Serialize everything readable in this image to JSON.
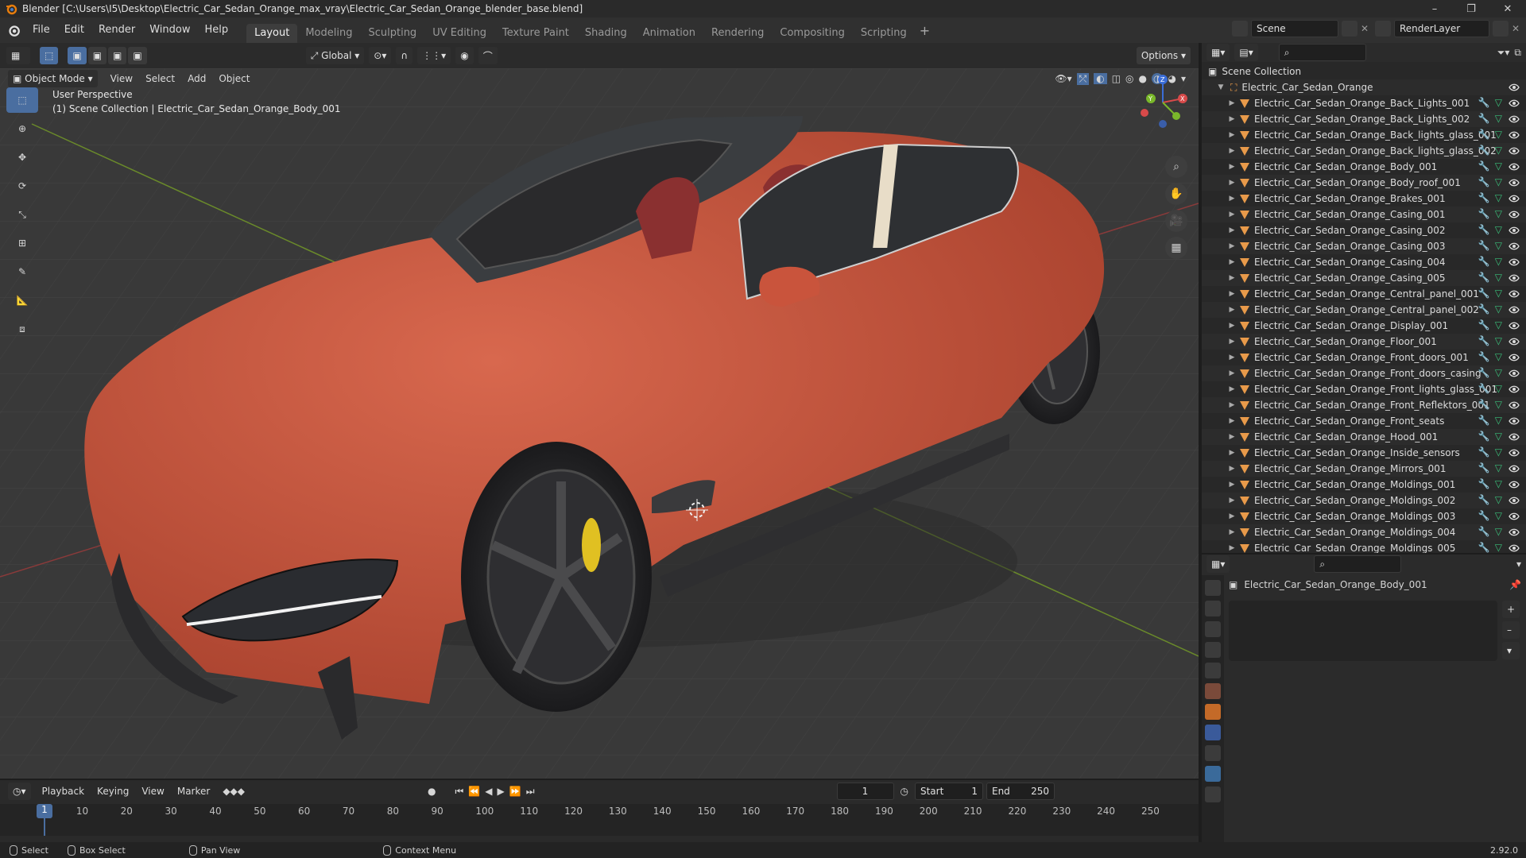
{
  "window": {
    "title": "Blender [C:\\Users\\I5\\Desktop\\Electric_Car_Sedan_Orange_max_vray\\Electric_Car_Sedan_Orange_blender_base.blend]"
  },
  "menu": [
    "File",
    "Edit",
    "Render",
    "Window",
    "Help"
  ],
  "workspaces": [
    {
      "label": "Layout",
      "active": true
    },
    {
      "label": "Modeling"
    },
    {
      "label": "Sculpting"
    },
    {
      "label": "UV Editing"
    },
    {
      "label": "Texture Paint"
    },
    {
      "label": "Shading"
    },
    {
      "label": "Animation"
    },
    {
      "label": "Rendering"
    },
    {
      "label": "Compositing"
    },
    {
      "label": "Scripting"
    }
  ],
  "scene": {
    "label": "Scene",
    "render_layer": "RenderLayer"
  },
  "toolheader": {
    "orientation": "Global",
    "options": "Options"
  },
  "viewport_header": {
    "mode": "Object Mode",
    "menus": [
      "View",
      "Select",
      "Add",
      "Object"
    ]
  },
  "viewport_info": {
    "perspective": "User Perspective",
    "collection": "(1) Scene Collection | Electric_Car_Sedan_Orange_Body_001"
  },
  "outliner": {
    "root": "Scene Collection",
    "collection": "Electric_Car_Sedan_Orange",
    "items": [
      "Electric_Car_Sedan_Orange_Back_Lights_001",
      "Electric_Car_Sedan_Orange_Back_Lights_002",
      "Electric_Car_Sedan_Orange_Back_lights_glass_001",
      "Electric_Car_Sedan_Orange_Back_lights_glass_002",
      "Electric_Car_Sedan_Orange_Body_001",
      "Electric_Car_Sedan_Orange_Body_roof_001",
      "Electric_Car_Sedan_Orange_Brakes_001",
      "Electric_Car_Sedan_Orange_Casing_001",
      "Electric_Car_Sedan_Orange_Casing_002",
      "Electric_Car_Sedan_Orange_Casing_003",
      "Electric_Car_Sedan_Orange_Casing_004",
      "Electric_Car_Sedan_Orange_Casing_005",
      "Electric_Car_Sedan_Orange_Central_panel_001",
      "Electric_Car_Sedan_Orange_Central_panel_002",
      "Electric_Car_Sedan_Orange_Display_001",
      "Electric_Car_Sedan_Orange_Floor_001",
      "Electric_Car_Sedan_Orange_Front_doors_001",
      "Electric_Car_Sedan_Orange_Front_doors_casing",
      "Electric_Car_Sedan_Orange_Front_lights_glass_001",
      "Electric_Car_Sedan_Orange_Front_Reflektors_001",
      "Electric_Car_Sedan_Orange_Front_seats",
      "Electric_Car_Sedan_Orange_Hood_001",
      "Electric_Car_Sedan_Orange_Inside_sensors",
      "Electric_Car_Sedan_Orange_Mirrors_001",
      "Electric_Car_Sedan_Orange_Moldings_001",
      "Electric_Car_Sedan_Orange_Moldings_002",
      "Electric_Car_Sedan_Orange_Moldings_003",
      "Electric_Car_Sedan_Orange_Moldings_004",
      "Electric_Car_Sedan_Orange_Moldings_005"
    ]
  },
  "properties": {
    "object_name": "Electric_Car_Sedan_Orange_Body_001"
  },
  "timeline": {
    "menus": [
      "Playback",
      "Keying",
      "View",
      "Marker"
    ],
    "current_frame": "1",
    "start_label": "Start",
    "start": "1",
    "end_label": "End",
    "end": "250",
    "ticks": [
      "1",
      "10",
      "20",
      "30",
      "40",
      "50",
      "60",
      "70",
      "80",
      "90",
      "100",
      "110",
      "120",
      "130",
      "140",
      "150",
      "160",
      "170",
      "180",
      "190",
      "200",
      "210",
      "220",
      "230",
      "240",
      "250"
    ]
  },
  "statusbar": {
    "select": "Select",
    "box_select": "Box Select",
    "pan_view": "Pan View",
    "context_menu": "Context Menu",
    "version": "2.92.0"
  },
  "colors": {
    "accent": "#4a6ea0",
    "car_body": "#c9543c",
    "object_icon": "#e89a4a"
  }
}
